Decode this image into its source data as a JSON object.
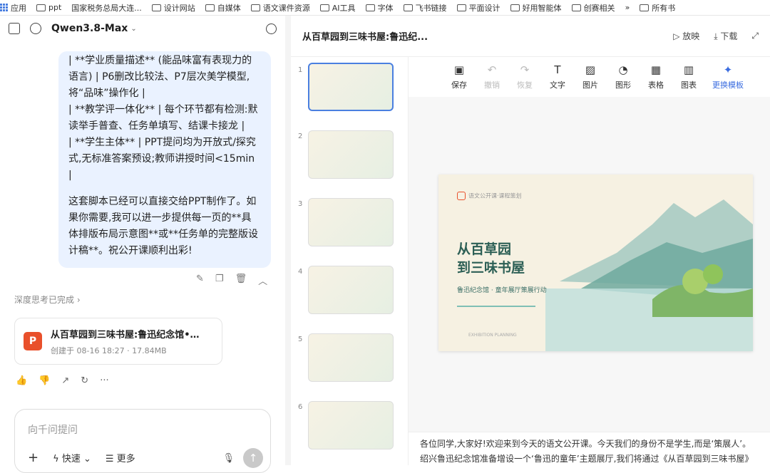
{
  "bookmarks": [
    "应用",
    "ppt",
    "国家税务总局大连...",
    "设计网站",
    "自媒体",
    "语文课件资源",
    "AI工具",
    "字体",
    "飞书链接",
    "平面设计",
    "好用智能体",
    "创赛相关",
    "»",
    "所有书"
  ],
  "chat": {
    "model": "Qwen3.8-Max",
    "lines": [
      "| **学业质量描述** (能品味富有表现力的语言) | P6删改比较法、P7层次美学模型,将“品味”操作化 |",
      "| **教学评一体化** | 每个环节都有检测:默读举手普查、任务单填写、结课卡接龙 |",
      "| **学生主体** | PPT提问均为开放式/探究式,无标准答案预设;教师讲授时间<15min |",
      "这套脚本已经可以直接交给PPT制作了。如果你需要,我可以进一步提供每一页的**具体排版布局示意图**或**任务单的完整版设计稿**。祝公开课顺利出彩!"
    ],
    "deep": "深度思考已完成 ›",
    "file": {
      "name": "从百草园到三味书屋:鲁迅纪念馆•童...",
      "meta": "创建于 08-16 18:27 · 17.84MB"
    },
    "input_placeholder": "向千问提问",
    "quick": "快速",
    "more": "更多"
  },
  "doc": {
    "title": "从百草园到三味书屋:鲁迅纪...",
    "play": "放映",
    "download": "下载"
  },
  "toolbar": [
    "保存",
    "撤销",
    "恢复",
    "文字",
    "图片",
    "图形",
    "表格",
    "图表",
    "更换模板"
  ],
  "slide": {
    "logo": "语文公开课·课程策划",
    "h1a": "从百草园",
    "h1b": "到三味书屋",
    "sub": "鲁迅纪念馆 · 童年展厅策展行动",
    "foot": "EXHIBITION PLANNING"
  },
  "notes": "各位同学,大家好!欢迎来到今天的语文公开课。今天我们的身份不是学生,而是‘策展人’。绍兴鲁迅纪念馆准备增设一个‘鲁迅的童年’主题展厅,我们将通过《从百草园到三味书屋》这篇课文,"
}
